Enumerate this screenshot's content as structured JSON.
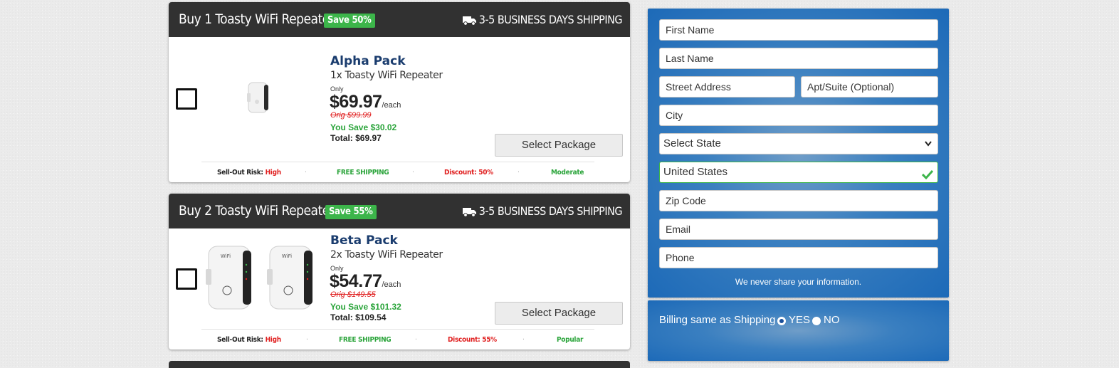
{
  "packages": [
    {
      "title": "Buy 1 Toasty WiFi Repeater",
      "badge": "Save 50%",
      "shipping": "3-5 BUSINESS DAYS SHIPPING",
      "name": "Alpha Pack",
      "subtitle": "1x Toasty WiFi Repeater",
      "only": "Only",
      "price": "$69.97",
      "each": "/each",
      "orig": "Orig $99.99",
      "save": "You Save $30.02",
      "total": "Total: $69.97",
      "button": "Select Package",
      "risk_label": "Sell-Out Risk:",
      "risk_value": "High",
      "free_shipping": "FREE SHIPPING",
      "discount": "Discount: 50%",
      "tag": "Moderate"
    },
    {
      "title": "Buy 2 Toasty WiFi Repeater",
      "badge": "Save 55%",
      "shipping": "3-5 BUSINESS DAYS SHIPPING",
      "name": "Beta Pack",
      "subtitle": "2x Toasty WiFi Repeater",
      "only": "Only",
      "price": "$54.77",
      "each": "/each",
      "orig": "Orig $149.55",
      "save": "You Save $101.32",
      "total": "Total: $109.54",
      "button": "Select Package",
      "risk_label": "Sell-Out Risk:",
      "risk_value": "High",
      "free_shipping": "FREE SHIPPING",
      "discount": "Discount: 55%",
      "tag": "Popular"
    }
  ],
  "form": {
    "first_name": "First Name",
    "last_name": "Last Name",
    "street": "Street Address",
    "apt": "Apt/Suite (Optional)",
    "city": "City",
    "state": "Select State",
    "country": "United States",
    "zip": "Zip Code",
    "email": "Email",
    "phone": "Phone",
    "note": "We never share your information."
  },
  "billing": {
    "label": "Billing same as Shipping",
    "yes": "YES",
    "no": "NO",
    "selected": "YES"
  },
  "icons": {
    "truck": "truck-icon",
    "check": "checkmark-icon",
    "chevron": "chevron-down-icon"
  }
}
